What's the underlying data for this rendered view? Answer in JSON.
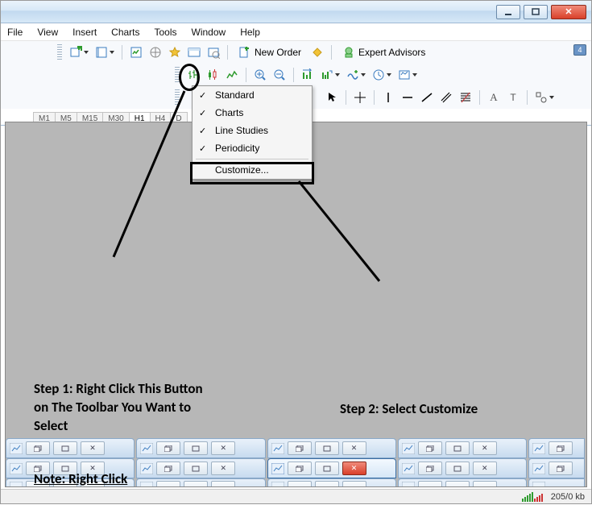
{
  "menubar": [
    "File",
    "View",
    "Insert",
    "Charts",
    "Tools",
    "Window",
    "Help"
  ],
  "toolbar": {
    "new_order": "New Order",
    "expert_advisors": "Expert Advisors",
    "alert_badge": "4"
  },
  "timeframes": [
    "M1",
    "M5",
    "M15",
    "M30",
    "H1",
    "H4",
    "D"
  ],
  "active_timeframe": "H1",
  "context_menu": {
    "items": [
      {
        "label": "Standard",
        "checked": true
      },
      {
        "label": "Charts",
        "checked": true
      },
      {
        "label": "Line Studies",
        "checked": true
      },
      {
        "label": "Periodicity",
        "checked": true
      }
    ],
    "customize": "Customize..."
  },
  "annotations": {
    "step1": "Step 1: Right Click This Button on The Toolbar You Want to Select",
    "step2": "Step 2: Select Customize",
    "note": "Note: Right Click"
  },
  "status": {
    "traffic": "205/0 kb"
  }
}
